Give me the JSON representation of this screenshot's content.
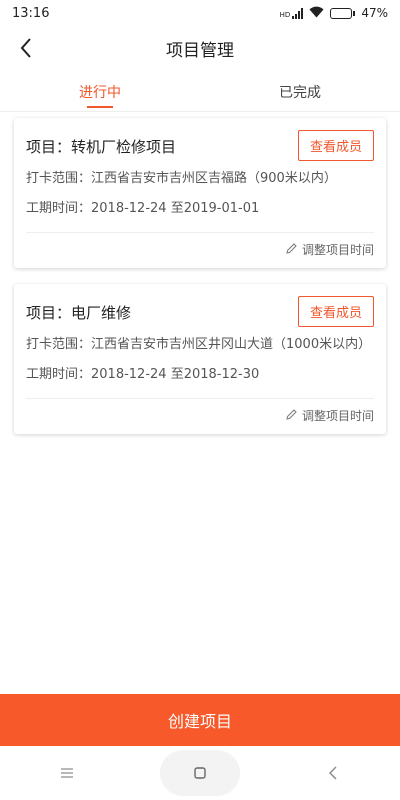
{
  "status_bar": {
    "time": "13:16",
    "network_label": "HD",
    "battery_percent": "47%",
    "battery_level": 0.47
  },
  "header": {
    "title": "项目管理"
  },
  "tabs": [
    {
      "label": "进行中",
      "active": true
    },
    {
      "label": "已完成",
      "active": false
    }
  ],
  "projects": [
    {
      "title": "项目：转机厂检修项目",
      "view_members_label": "查看成员",
      "range_label": "打卡范围：",
      "range_value": "江西省吉安市吉州区吉福路（900米以内）",
      "period_label": "工期时间：",
      "period_value": "2018-12-24  至2019-01-01",
      "adjust_label": "调整项目时间"
    },
    {
      "title": "项目：电厂维修",
      "view_members_label": "查看成员",
      "range_label": "打卡范围：",
      "range_value": "江西省吉安市吉州区井冈山大道（1000米以内）",
      "period_label": "工期时间：",
      "period_value": "2018-12-24  至2018-12-30",
      "adjust_label": "调整项目时间"
    }
  ],
  "create_button_label": "创建项目",
  "colors": {
    "accent": "#f2572b",
    "create_button": "#f7592b"
  }
}
